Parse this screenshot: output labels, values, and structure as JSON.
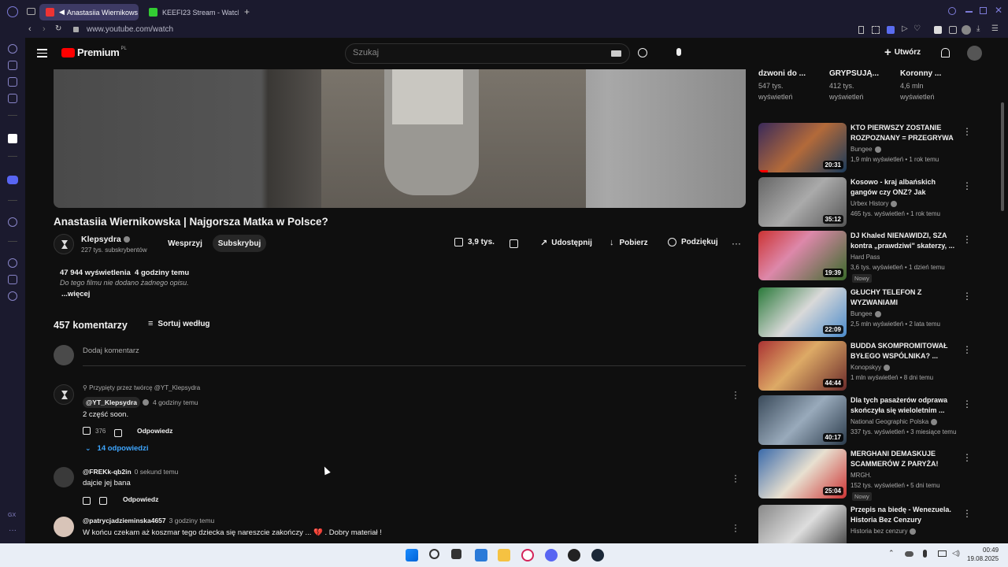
{
  "browser": {
    "tabs": [
      {
        "label": "Anastasiia Wiernikows",
        "active": true
      },
      {
        "label": "KEEFI23 Stream - Watch l",
        "active": false
      }
    ],
    "url": "www.youtube.com/watch"
  },
  "youtube": {
    "logo_text": "Premium",
    "logo_region": "PL",
    "search_placeholder": "Szukaj",
    "create_label": "Utwórz"
  },
  "video": {
    "title": "Anastasiia Wiernikowska | Najgorsza Matka w Polsce?",
    "channel": "Klepsydra",
    "subscribers": "227 tys. subskrybentów",
    "support_label": "Wesprzyj",
    "subscribe_label": "Subskrybuj",
    "likes": "3,9 tys.",
    "share_label": "Udostępnij",
    "download_label": "Pobierz",
    "thanks_label": "Podziękuj",
    "views_line": "47 944 wyświetlenia  4 godziny temu",
    "description": "Do tego filmu nie dodano żadnego opisu.",
    "more_label": "...więcej"
  },
  "comments": {
    "count_label": "457 komentarzy",
    "sort_label": "Sortuj według",
    "add_placeholder": "Dodaj komentarz",
    "items": [
      {
        "pinned": "Przypięty przez twórcę @YT_Klepsydra",
        "handle": "@YT_Klepsydra",
        "time": "4 godziny temu",
        "text": "2 część soon.",
        "likes": "376",
        "reply_label": "Odpowiedz",
        "replies_label": "14 odpowiedzi"
      },
      {
        "handle": "@FREKk-qb2in",
        "time": "0 sekund temu",
        "text": "dajcie jej bana",
        "reply_label": "Odpowiedz"
      },
      {
        "handle": "@patrycjadzieminska4657",
        "time": "3 godziny temu",
        "text": "W końcu czekam aż koszmar tego dziecka się nareszcie zakończy ... 💔 . Dobry materiał !"
      }
    ]
  },
  "sidebar": {
    "top_partial": [
      {
        "title": "dzwoni do ...",
        "meta1": "547 tys.",
        "meta2": "wyświetleń"
      },
      {
        "title": "GRYPSUJĄ...",
        "meta1": "412 tys.",
        "meta2": "wyświetleń"
      },
      {
        "title": "Koronny ...",
        "meta1": "4,6 mln",
        "meta2": "wyświetleń"
      }
    ],
    "recs": [
      {
        "title": "KTO PIERWSZY ZOSTANIE ROZPOZNANY = PRZEGRYWA",
        "channel": "Bungee",
        "meta": "1,9 mln wyświetleń • 1 rok temu",
        "duration": "20:31",
        "badge": ""
      },
      {
        "title": "Kosowo - kraj albańskich gangów czy ONZ? Jak wygląd...",
        "channel": "Urbex History",
        "meta": "465 tys. wyświetleń • 1 rok temu",
        "duration": "35:12",
        "badge": ""
      },
      {
        "title": "DJ Khaled NIENAWIDZI, SZA kontra „prawdziwi\" skaterzy, ...",
        "channel": "Hard Pass",
        "meta": "3,6 tys. wyświetleń • 1 dzień temu",
        "duration": "19:39",
        "badge": "Nowy"
      },
      {
        "title": "GŁUCHY TELEFON Z WYZWANIAMI",
        "channel": "Bungee",
        "meta": "2,5 mln wyświetleń • 2 lata temu",
        "duration": "22:09",
        "badge": ""
      },
      {
        "title": "BUDDA SKOMPROMITOWAŁ BYŁEGO WSPÓLNIKA? ...",
        "channel": "Konopskyy",
        "meta": "1 mln wyświetleń • 8 dni temu",
        "duration": "44:44",
        "badge": ""
      },
      {
        "title": "Dla tych pasażerów odprawa skończyła się wieloletnim ...",
        "channel": "National Geographic Polska",
        "meta": "337 tys. wyświetleń • 3 miesiące temu",
        "duration": "40:17",
        "badge": ""
      },
      {
        "title": "MERGHANI DEMASKUJE SCAMMERÓW Z PARYŻA!",
        "channel": "MRGH.",
        "meta": "152 tys. wyświetleń • 5 dni temu",
        "duration": "25:04",
        "badge": "Nowy"
      },
      {
        "title": "Przepis na biedę - Wenezuela. Historia Bez Cenzury",
        "channel": "Historia bez cenzury",
        "meta": "",
        "duration": "",
        "badge": ""
      }
    ]
  },
  "taskbar": {
    "time": "00:49",
    "date": "19.08.2025",
    "gx_label": "GX"
  }
}
